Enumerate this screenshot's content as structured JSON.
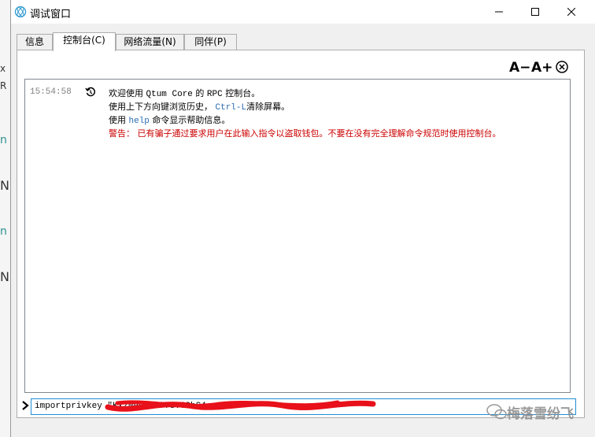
{
  "background": {
    "fragments": [
      {
        "text": "x"
      },
      {
        "text": "R"
      },
      {
        "text": "n"
      },
      {
        "text": "N"
      },
      {
        "text": "n"
      },
      {
        "text": "N"
      }
    ]
  },
  "window": {
    "title": "调试窗口",
    "icons": {
      "app": "qtum-icon",
      "minimize": "minimize-icon",
      "maximize": "maximize-icon",
      "close": "close-icon"
    }
  },
  "tabs": [
    {
      "label": "信息",
      "active": false
    },
    {
      "label": "控制台(C)",
      "active": true
    },
    {
      "label": "网络流量(N)",
      "active": false
    },
    {
      "label": "同伴(P)",
      "active": false
    }
  ],
  "toolbar": {
    "font_smaller": "A−",
    "font_larger": "A+",
    "clear_icon": "clear-icon"
  },
  "console": {
    "timestamp": "15:54:58",
    "line1": {
      "pre": "欢迎使用 ",
      "app": "Qtum Core",
      "mid": " 的 ",
      "rpc": "RPC",
      "post": " 控制台。"
    },
    "line2": {
      "pre": "使用上下方向键浏览历史， ",
      "key": "Ctrl-L",
      "post": "清除屏幕。"
    },
    "line3": {
      "pre": "使用 ",
      "cmd": "help",
      "post": " 命令显示帮助信息。"
    },
    "warning": "警告：  已有骗子通过要求用户在此输入指令以盗取钱包。不要在没有完全理解命令规范时使用控制台。",
    "input_value": "importprivkey \"KxzN99u1rP73TC8hC4..."
  },
  "colors": {
    "warning": "#cc0000",
    "code": "#2b6cb0",
    "input_border": "#1e8fd5",
    "redaction": "#e8101a"
  },
  "watermark": {
    "text": "梅落雪纷飞"
  }
}
